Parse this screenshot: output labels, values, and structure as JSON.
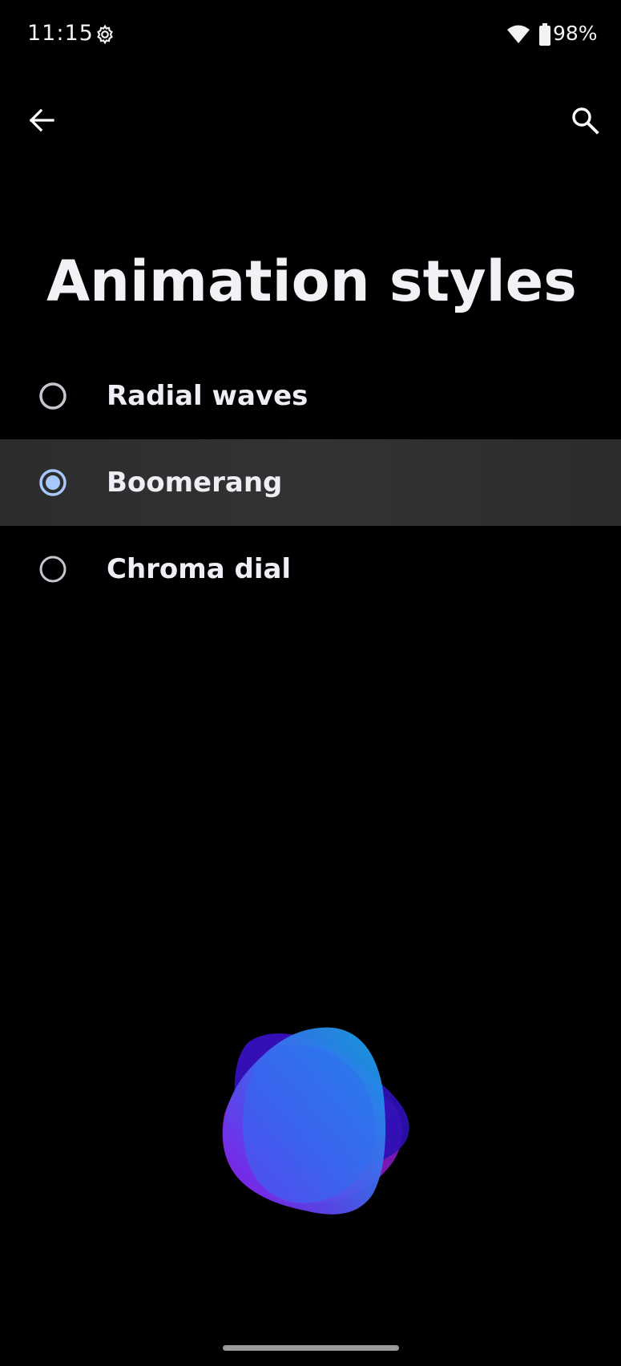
{
  "status_bar": {
    "time": "11:15",
    "battery": "98%",
    "icons": [
      "settings-gear-icon",
      "wifi-icon",
      "battery-icon"
    ]
  },
  "toolbar": {
    "back_icon": "arrow-back-icon",
    "search_icon": "search-icon"
  },
  "page": {
    "title": "Animation styles"
  },
  "options": [
    {
      "label": "Radial waves",
      "selected": false
    },
    {
      "label": "Boomerang",
      "selected": true
    },
    {
      "label": "Chroma dial",
      "selected": false
    }
  ],
  "colors": {
    "background": "#000000",
    "selected_row": "#2f2f2f",
    "radio_selected": "#a8c7fa",
    "radio_unselected": "#c4c6d0",
    "text": "#eeeef4"
  }
}
